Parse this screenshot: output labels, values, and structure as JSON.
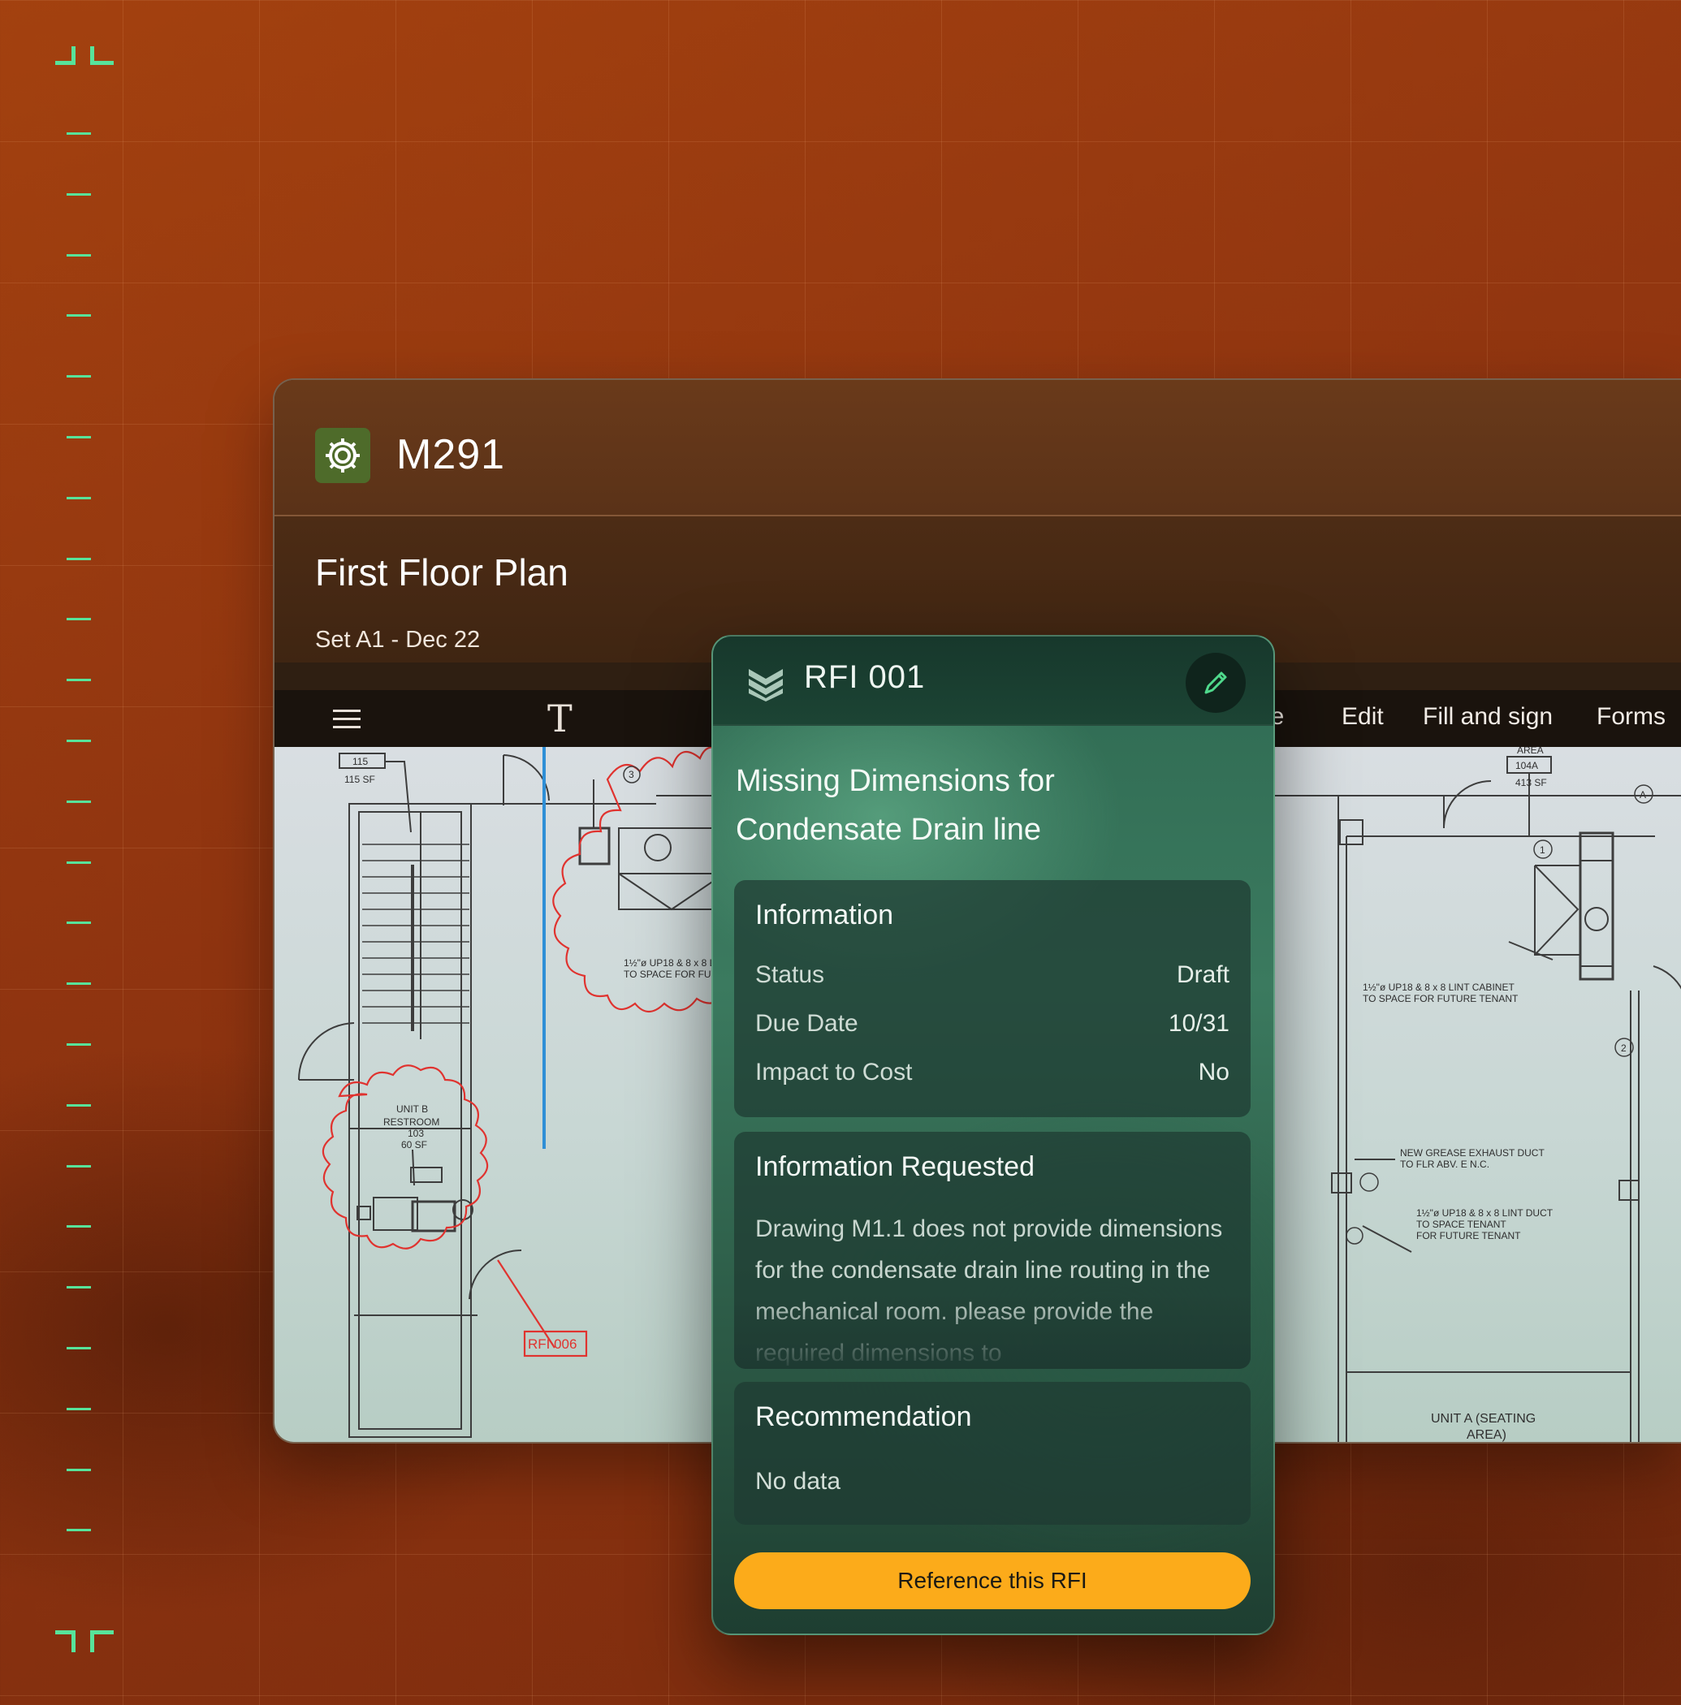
{
  "app": {
    "title": "M291",
    "icon": "gear-icon"
  },
  "plan": {
    "title": "First Floor Plan",
    "subtitle": "Set A1 - Dec 22"
  },
  "toolbar": {
    "menu_icon": "hamburger-menu-icon",
    "text_tool_icon": "text-tool-icon",
    "items": [
      "ure",
      "Edit",
      "Fill and sign",
      "Forms"
    ]
  },
  "drawing": {
    "labels_left": [
      "115",
      "115 SF",
      "UNIT B",
      "RESTROOM",
      "103",
      "60 SF",
      "RFI 006",
      "1½\"ø UP18 & 8 x 8 L",
      "TO SPACE FOR FUTU",
      "3"
    ],
    "labels_right": [
      "AREA",
      "104A",
      "413 SF",
      "1½\"ø UP18 & 8 x 8 LINT CABINET",
      "TO SPACE FOR FUTURE TENANT",
      "NEW GREASE EXHAUST DUCT",
      "TO FLR ABV. E N.C.",
      "1½\"ø UP18 & 8 x 8 LINT DUCT",
      "TO SPACE TENANT",
      "FOR FUTURE TENANT",
      "UNIT A (SEATING",
      "AREA)",
      "A",
      "1",
      "2"
    ]
  },
  "rfi": {
    "id": "RFI 001",
    "logo_icon": "layers-chevron-icon",
    "edit_icon": "pencil-icon",
    "title": "Missing Dimensions for Condensate Drain line",
    "information": {
      "heading": "Information",
      "rows": [
        {
          "label": "Status",
          "value": "Draft"
        },
        {
          "label": "Due Date",
          "value": "10/31"
        },
        {
          "label": "Impact to Cost",
          "value": "No"
        }
      ]
    },
    "requested": {
      "heading": "Information Requested",
      "text": "Drawing M1.1 does not provide dimensions for the condensate drain line routing in the mechanical room. please provide the required dimensions to"
    },
    "recommendation": {
      "heading": "Recommendation",
      "text": "No data"
    },
    "button_label": "Reference this RFI"
  },
  "colors": {
    "accent_green": "#57e39a",
    "button_yellow": "#fcab1a",
    "background_orange": "#93380f",
    "card_green": "#2f6a52",
    "markup_red": "#e0332f",
    "markup_blue": "#2f8fd6"
  }
}
